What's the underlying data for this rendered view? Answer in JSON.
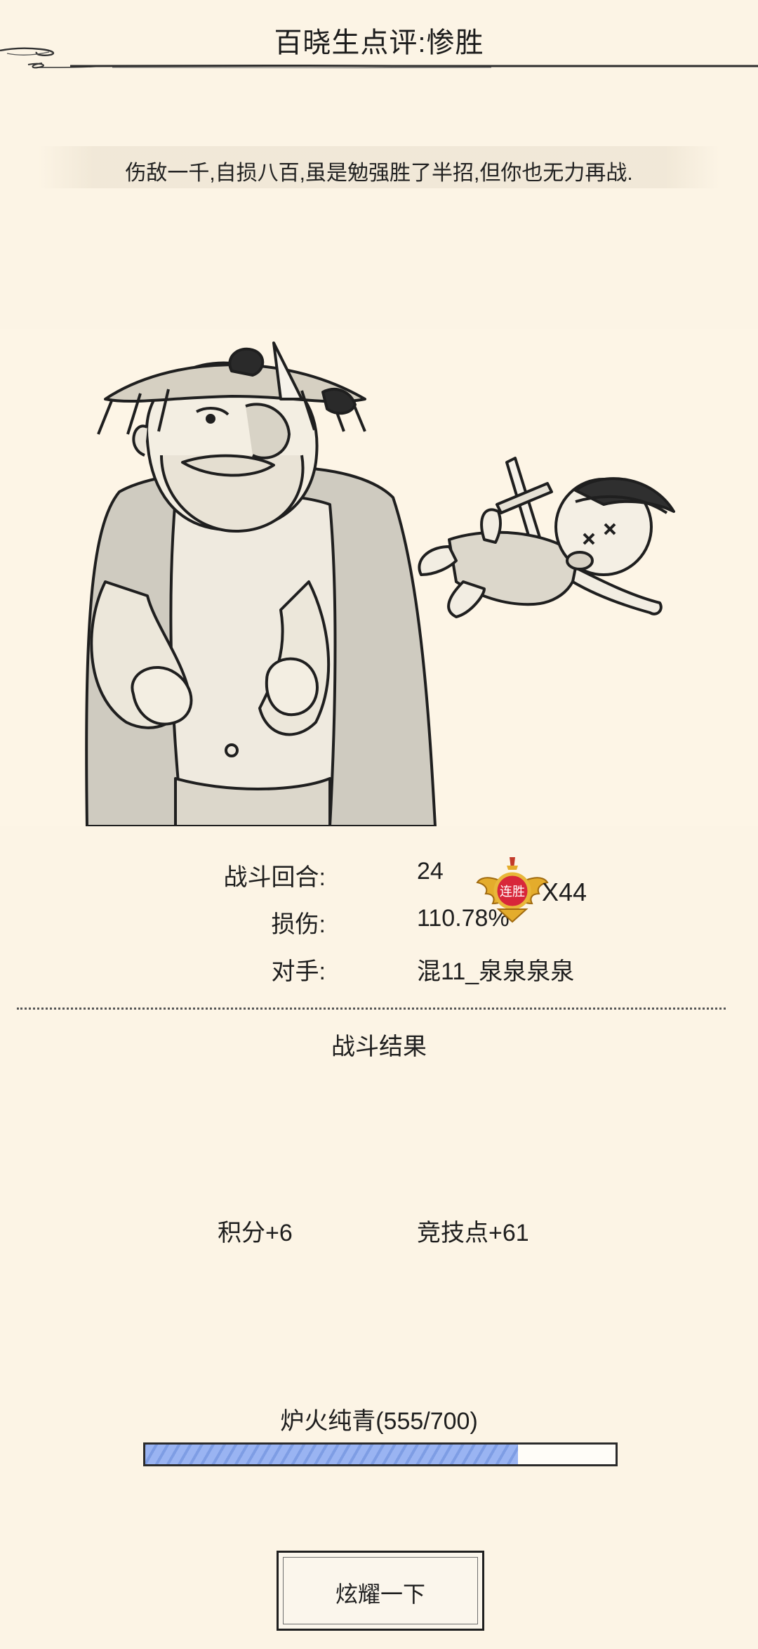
{
  "header": {
    "title": "百晓生点评:惨胜"
  },
  "comment": {
    "text": "伤敌一千,自损八百,虽是勉强胜了半招,但你也无力再战."
  },
  "stats": {
    "rounds_label": "战斗回合:",
    "rounds_value": "24",
    "damage_label": "损伤:",
    "damage_value": "110.78%",
    "opponent_label": "对手:",
    "opponent_value": "混11_泉泉泉泉",
    "streak_badge_text": "连胜",
    "streak_count": "X44"
  },
  "result": {
    "title": "战斗结果",
    "points": "积分+6",
    "arena_points": "竞技点+61"
  },
  "progress": {
    "label": "炉火纯青(555/700)",
    "current": 555,
    "max": 700
  },
  "actions": {
    "show_off": "炫耀一下"
  },
  "icons": {
    "streak": "winged-streak-badge-icon",
    "side": "float-menu-icon"
  },
  "colors": {
    "background": "#fcf4e5",
    "progress_fill": "#9ab4f2",
    "badge_red": "#d8273a",
    "badge_gold": "#e0a82a"
  }
}
